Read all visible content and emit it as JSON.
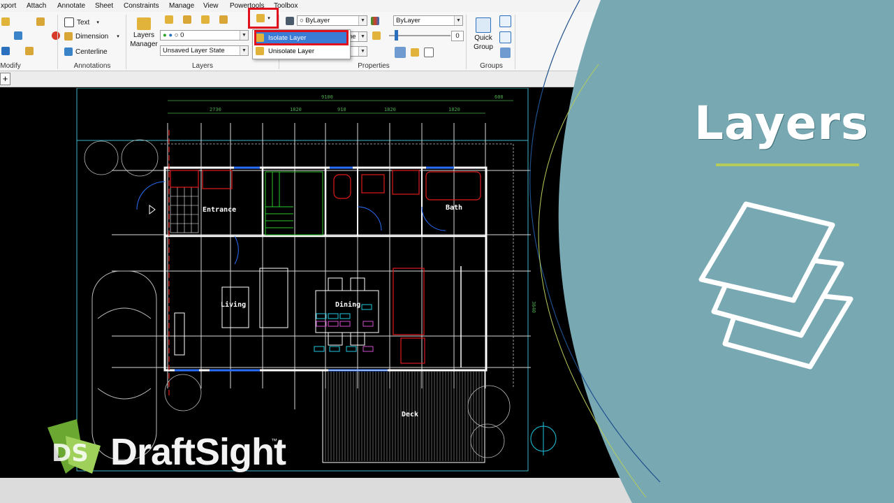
{
  "menu": [
    "xport",
    "Attach",
    "Annotate",
    "Sheet",
    "Constraints",
    "Manage",
    "View",
    "Powertools",
    "Toolbox"
  ],
  "ribbon": {
    "groups": {
      "modify": "Modify",
      "annotations": "Annotations",
      "layers": "Layers",
      "properties": "Properties",
      "groups": "Groups"
    },
    "annotations": {
      "text": "Text",
      "dimension": "Dimension",
      "centerline": "Centerline"
    },
    "layers": {
      "manager_line1": "Layers",
      "manager_line2": "Manager",
      "layer_value": "0",
      "layer_state": "Unsaved Layer State"
    },
    "properties": {
      "color": "ByLayer",
      "linetype": "ByLayer",
      "linetype_suffix": "ne",
      "transparency": "0"
    },
    "groups_panel": {
      "quick_line1": "Quick",
      "quick_line2": "Group"
    }
  },
  "dropdown": {
    "isolate": "Isolate Layer",
    "unisolate": "Unisolate Layer"
  },
  "tabs": {
    "add": "+"
  },
  "drawing": {
    "rooms": {
      "entrance": "Entrance",
      "bath": "Bath",
      "living": "Living",
      "dining": "Dining",
      "deck": "Deck"
    },
    "dims": {
      "overall": "9100",
      "d1": "2730",
      "d2": "1820",
      "d3": "910",
      "d4": "1820",
      "d5": "1820",
      "right": "600",
      "side": "3640"
    }
  },
  "overlay": {
    "title": "Layers",
    "logo": "DraftSight",
    "logo_mark": "DS",
    "tm": "™"
  },
  "colors": {
    "panel": "#78a9b3",
    "accent_line": "#b6cc5a",
    "highlight": "#e0101c",
    "selected_item": "#3a7bd5"
  }
}
